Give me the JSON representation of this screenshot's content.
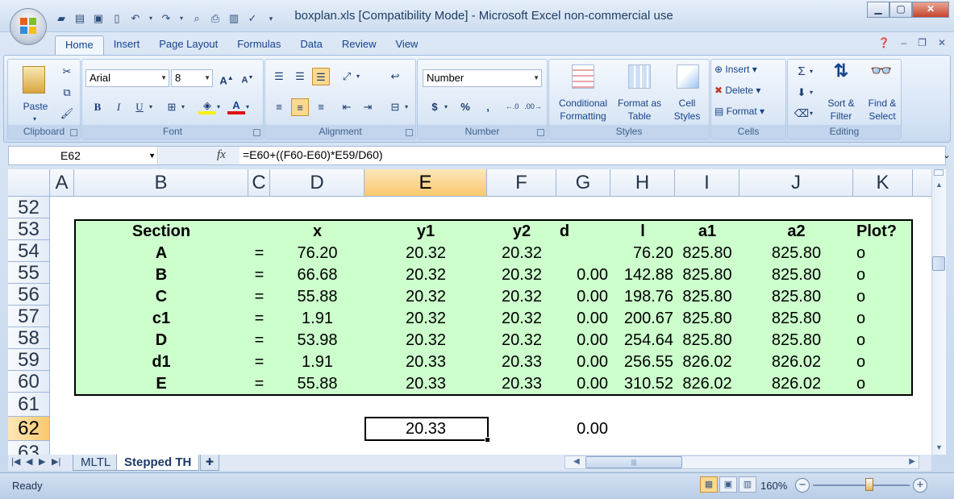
{
  "window": {
    "title": "boxplan.xls  [Compatibility Mode] - Microsoft Excel non-commercial use",
    "controls": [
      "minimize",
      "maximize",
      "close"
    ]
  },
  "ribbon": {
    "tabs": [
      "Home",
      "Insert",
      "Page Layout",
      "Formulas",
      "Data",
      "Review",
      "View"
    ],
    "active_tab": "Home",
    "groups": {
      "clipboard": {
        "label": "Clipboard",
        "paste": "Paste"
      },
      "font": {
        "label": "Font",
        "font_name": "Arial",
        "font_size": "8",
        "bold": "B",
        "italic": "I",
        "underline": "U"
      },
      "alignment": {
        "label": "Alignment"
      },
      "number": {
        "label": "Number",
        "format": "Number",
        "currency": "$",
        "percent": "%",
        "comma": ","
      },
      "styles": {
        "label": "Styles",
        "conditional_formatting": "Conditional Formatting",
        "format_as_table": "Format as Table",
        "cell_styles": "Cell Styles"
      },
      "cells": {
        "label": "Cells",
        "insert": "Insert",
        "delete": "Delete",
        "format": "Format"
      },
      "editing": {
        "label": "Editing",
        "sort_filter": "Sort & Filter",
        "find_select": "Find & Select"
      }
    }
  },
  "formula_bar": {
    "name_box": "E62",
    "fx": "fx",
    "formula": "=E60+((F60-E60)*E59/D60)"
  },
  "columns": [
    "A",
    "B",
    "C",
    "D",
    "E",
    "F",
    "G",
    "H",
    "I",
    "J",
    "K"
  ],
  "selected_column": "E",
  "rows": [
    "52",
    "53",
    "54",
    "55",
    "56",
    "57",
    "58",
    "59",
    "60",
    "61",
    "62",
    "63"
  ],
  "selected_row": "62",
  "table": {
    "headers": {
      "section": "Section",
      "x": "x",
      "y1": "y1",
      "y2": "y2",
      "d": "d",
      "l": "l",
      "a1": "a1",
      "a2": "a2",
      "plot": "Plot?"
    },
    "rows": [
      {
        "section": "A",
        "eq": "=",
        "x": "76.20",
        "y1": "20.32",
        "y2": "20.32",
        "d": "",
        "l": "76.20",
        "a1": "825.80",
        "a2": "825.80",
        "plot": "o"
      },
      {
        "section": "B",
        "eq": "=",
        "x": "66.68",
        "y1": "20.32",
        "y2": "20.32",
        "d": "0.00",
        "l": "142.88",
        "a1": "825.80",
        "a2": "825.80",
        "plot": "o"
      },
      {
        "section": "C",
        "eq": "=",
        "x": "55.88",
        "y1": "20.32",
        "y2": "20.32",
        "d": "0.00",
        "l": "198.76",
        "a1": "825.80",
        "a2": "825.80",
        "plot": "o"
      },
      {
        "section": "c1",
        "eq": "=",
        "x": "1.91",
        "y1": "20.32",
        "y2": "20.32",
        "d": "0.00",
        "l": "200.67",
        "a1": "825.80",
        "a2": "825.80",
        "plot": "o"
      },
      {
        "section": "D",
        "eq": "=",
        "x": "53.98",
        "y1": "20.32",
        "y2": "20.32",
        "d": "0.00",
        "l": "254.64",
        "a1": "825.80",
        "a2": "825.80",
        "plot": "o"
      },
      {
        "section": "d1",
        "eq": "=",
        "x": "1.91",
        "y1": "20.33",
        "y2": "20.33",
        "d": "0.00",
        "l": "256.55",
        "a1": "826.02",
        "a2": "826.02",
        "plot": "o"
      },
      {
        "section": "E",
        "eq": "=",
        "x": "55.88",
        "y1": "20.33",
        "y2": "20.33",
        "d": "0.00",
        "l": "310.52",
        "a1": "826.02",
        "a2": "826.02",
        "plot": "o"
      }
    ]
  },
  "row62": {
    "e": "20.33",
    "g": "0.00"
  },
  "sheets": [
    "MLTL",
    "Stepped TH"
  ],
  "active_sheet": "Stepped TH",
  "status": {
    "ready": "Ready",
    "zoom": "160%"
  },
  "colors": {
    "table_fill": "#ccffcc",
    "selection_header": "#f9c96d"
  }
}
